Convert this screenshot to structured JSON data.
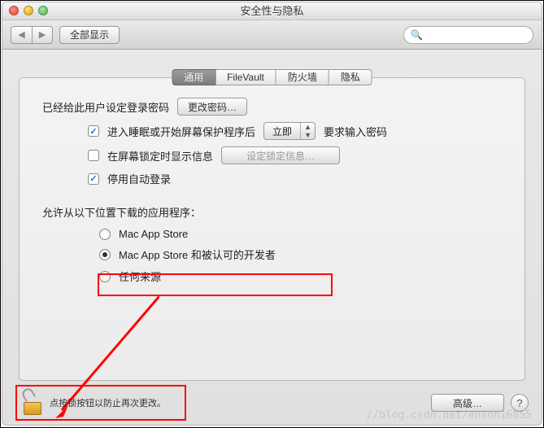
{
  "window": {
    "title": "安全性与隐私"
  },
  "toolbar": {
    "show_all": "全部显示"
  },
  "tabs": [
    "通用",
    "FileVault",
    "防火墙",
    "隐私"
  ],
  "general": {
    "pwd_set": "已经给此用户设定登录密码",
    "change_pwd": "更改密码…",
    "require_pwd_a": "进入睡眠或开始屏幕保护程序后",
    "require_pwd_b": "要求输入密码",
    "delay": "立即",
    "show_msg": "在屏幕锁定时显示信息",
    "set_lock_msg": "设定锁定信息…",
    "disable_auto": "停用自动登录"
  },
  "sources": {
    "label": "允许从以下位置下载的应用程序：",
    "opts": [
      "Mac App Store",
      "Mac App Store 和被认可的开发者",
      "任何来源"
    ]
  },
  "footer": {
    "lock_text": "点按锁按钮以防止再次更改。",
    "advanced": "高级…"
  },
  "watermark": "//blog.csdn.net/enson16855"
}
